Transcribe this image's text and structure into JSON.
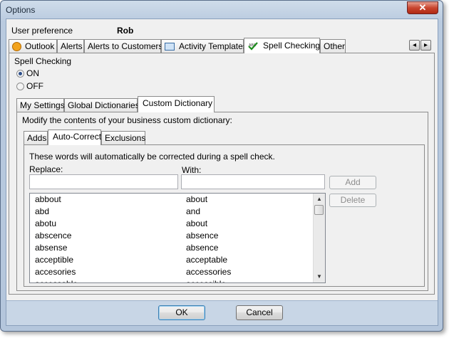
{
  "window": {
    "title": "Options",
    "close_glyph": "✕"
  },
  "user_pref": {
    "label": "User preference",
    "value": "Rob"
  },
  "main_tabs": [
    {
      "label": "Outlook",
      "icon": "outlook-icon"
    },
    {
      "label": "Alerts"
    },
    {
      "label": "Alerts to Customers"
    },
    {
      "label": "Activity Templates",
      "icon": "template-icon"
    },
    {
      "label": "Spell Checking",
      "icon": "spellcheck-icon",
      "icon_text": "ABC",
      "selected": true
    },
    {
      "label": "Other"
    }
  ],
  "tab_scroll": {
    "left": "◂",
    "right": "▸"
  },
  "spell": {
    "group_label": "Spell Checking",
    "options": [
      {
        "label": "ON",
        "checked": true
      },
      {
        "label": "OFF",
        "checked": false
      }
    ]
  },
  "sub_tabs": [
    {
      "label": "My Settings"
    },
    {
      "label": "Global Dictionaries"
    },
    {
      "label": "Custom Dictionary",
      "selected": true
    }
  ],
  "custom_dict": {
    "description": "Modify the contents of your business custom dictionary:",
    "tabs": [
      {
        "label": "Adds"
      },
      {
        "label": "Auto-Correct",
        "selected": true
      },
      {
        "label": "Exclusions"
      }
    ],
    "autocorrect": {
      "info": "These words will automatically be corrected during a spell check.",
      "replace_label": "Replace:",
      "with_label": "With:",
      "replace_value": "",
      "with_value": "",
      "add_label": "Add",
      "delete_label": "Delete",
      "rows": [
        {
          "replace": "abbout",
          "with": "about"
        },
        {
          "replace": "abd",
          "with": "and"
        },
        {
          "replace": "abotu",
          "with": "about"
        },
        {
          "replace": "abscence",
          "with": "absence"
        },
        {
          "replace": "absense",
          "with": "absence"
        },
        {
          "replace": "acceptible",
          "with": "acceptable"
        },
        {
          "replace": "accesories",
          "with": "accessories"
        },
        {
          "replace": "accessable",
          "with": "accessible"
        }
      ],
      "scroll_up": "▲",
      "scroll_down": "▼"
    }
  },
  "footer": {
    "ok_label": "OK",
    "cancel_label": "Cancel"
  }
}
